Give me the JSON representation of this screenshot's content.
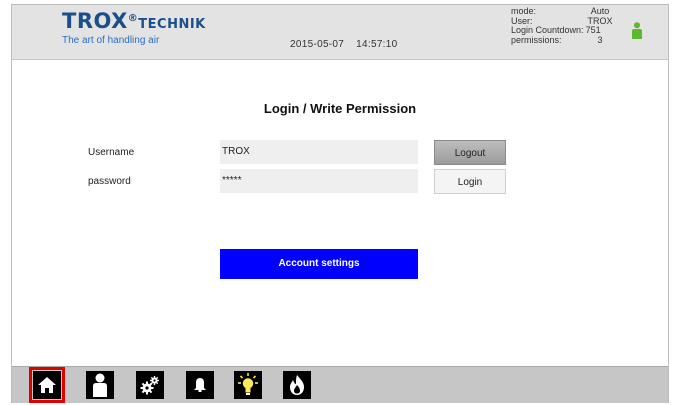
{
  "header": {
    "logo": {
      "brand": "TROX",
      "registered": "®",
      "sub_brand": "TECHNIK",
      "tagline": "The art of handling air"
    },
    "date": "2015-05-07",
    "time": "14:57:10",
    "status": {
      "mode_label": "mode:",
      "mode_value": "Auto",
      "user_label": "User:",
      "user_value": "TROX",
      "countdown_label": "Login Countdown:",
      "countdown_value": "751",
      "permissions_label": "permissions:",
      "permissions_value": "3"
    },
    "user_icon_color": "#5cb82e"
  },
  "login": {
    "title": "Login / Write Permission",
    "username_label": "Username",
    "username_value": "TROX",
    "password_label": "password",
    "password_value": "*****",
    "logout_button": "Logout",
    "login_button": "Login",
    "account_settings_button": "Account settings"
  },
  "colors": {
    "accent": "#0000ff",
    "active_outline": "#e00000",
    "logo_blue": "#1a4f8c"
  },
  "bottom_nav": [
    {
      "icon": "home-icon",
      "active": true
    },
    {
      "icon": "user-icon",
      "active": false
    },
    {
      "icon": "gears-icon",
      "active": false
    },
    {
      "icon": "bell-icon",
      "active": false
    },
    {
      "icon": "lightbulb-icon",
      "active": false
    },
    {
      "icon": "flame-icon",
      "active": false
    }
  ]
}
